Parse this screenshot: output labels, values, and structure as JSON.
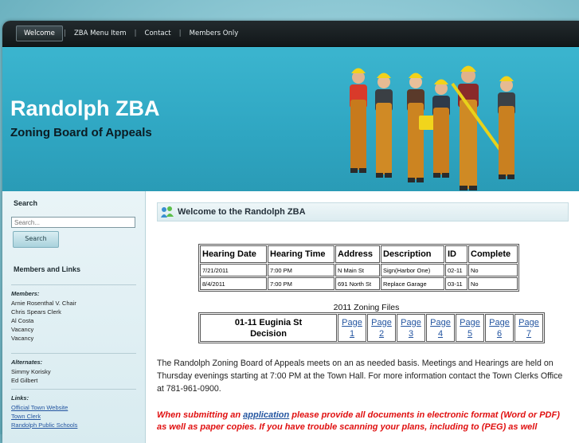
{
  "nav": {
    "items": [
      {
        "label": "Welcome"
      },
      {
        "label": "ZBA Menu Item"
      },
      {
        "label": "Contact"
      },
      {
        "label": "Members Only"
      }
    ]
  },
  "header": {
    "title": "Randolph ZBA",
    "subtitle": "Zoning Board of Appeals"
  },
  "sidebar": {
    "search_heading": "Search",
    "search_placeholder": "Search...",
    "search_button": "Search",
    "links_heading": "Members and Links",
    "members_heading": "Members:",
    "members": [
      "Arnie Rosenthal V. Chair",
      "Chris Spears Clerk",
      "Al Costa",
      "Vacancy",
      "Vacancy"
    ],
    "alternates_heading": "Alternates:",
    "alternates": [
      "Simmy Korisky",
      "Ed Gilbert"
    ],
    "links_label": "Links:",
    "links": [
      "Official Town Website",
      "Town Clerk",
      "Randolph Public Schools"
    ]
  },
  "main": {
    "welcome_title": "Welcome to the Randolph ZBA",
    "hearings": {
      "headers": [
        "Hearing Date",
        "Hearing Time",
        "Address",
        "Description",
        "ID",
        "Complete"
      ],
      "rows": [
        [
          "7/21/2011",
          "7:00 PM",
          "N Main St",
          "Sign(Harbor One)",
          "02-11",
          "No"
        ],
        [
          "8/4/2011",
          "7:00 PM",
          "691 North St",
          "Replace Garage",
          "03-11",
          "No"
        ]
      ]
    },
    "files": {
      "caption": "2011 Zoning Files",
      "file_line1": "01-11 Euginia St",
      "file_line2": "Decision",
      "pages": [
        {
          "word": "Page",
          "num": "1"
        },
        {
          "word": "Page",
          "num": "2"
        },
        {
          "word": "Page",
          "num": "3"
        },
        {
          "word": "Page",
          "num": "4"
        },
        {
          "word": "Page",
          "num": "5"
        },
        {
          "word": "Page",
          "num": "6"
        },
        {
          "word": "Page",
          "num": "7"
        }
      ]
    },
    "intro": "The Randolph Zoning Board of Appeals meets on an as needed basis. Meetings and Hearings are held on Thursday evenings starting at 7:00 PM at the Town Hall. For more information contact the Town Clerks Office at 781-961-0900.",
    "notice_before": "When submitting an ",
    "notice_link": "application",
    "notice_after": " please provide all documents in electronic format (Word or PDF) as well as paper copies. If you have trouble scanning your plans, including to (PEG) as well"
  },
  "colors": {
    "header_bg": "#2fa6c2",
    "nav_bg": "#1a2124",
    "link": "#2455a0",
    "notice": "#e01010"
  }
}
